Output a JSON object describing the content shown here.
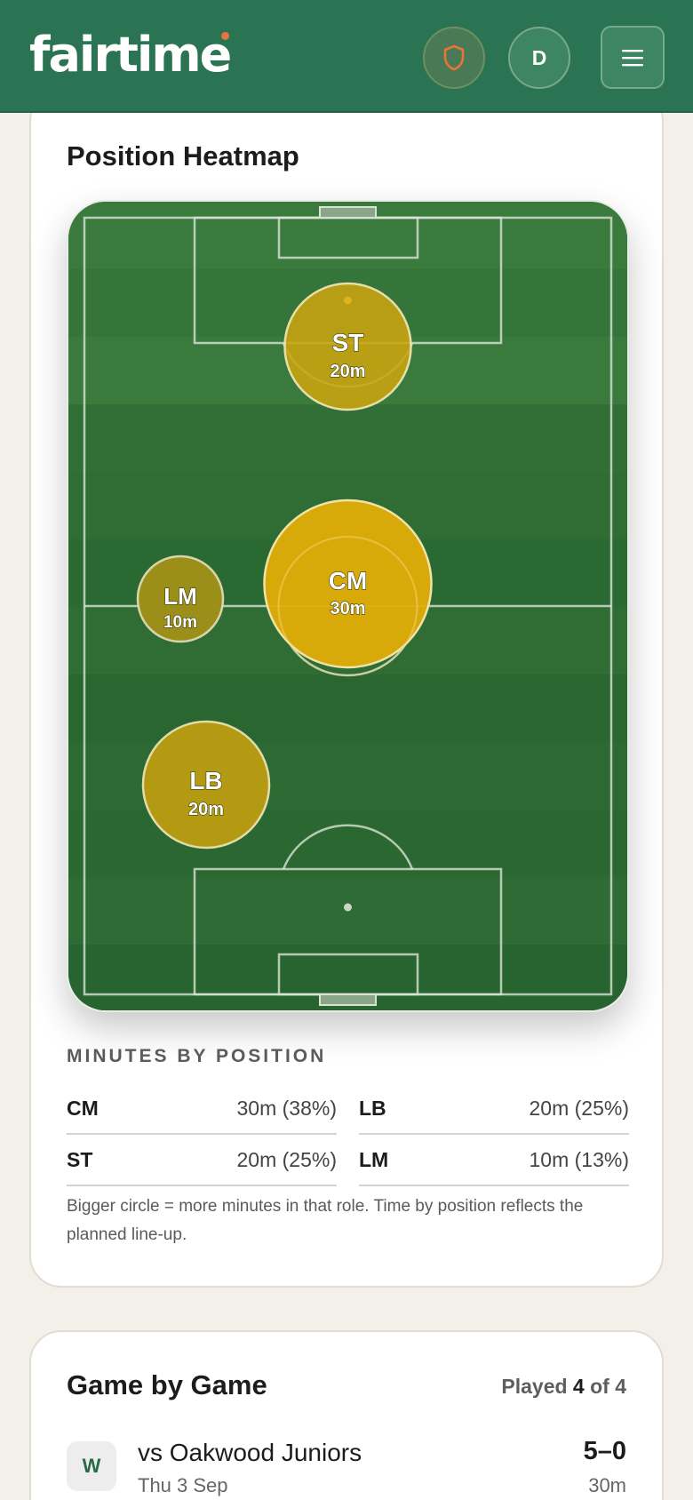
{
  "header": {
    "logo": "fairtime",
    "avatar_initial": "D",
    "icons": [
      "shield-icon",
      "menu-icon"
    ],
    "accent_color": "#e8743b",
    "brand_color": "#2a7454"
  },
  "heatmap": {
    "title": "Position Heatmap",
    "bubbles": [
      {
        "pos": "ST",
        "mins": "20m",
        "minutes": 20
      },
      {
        "pos": "CM",
        "mins": "30m",
        "minutes": 30
      },
      {
        "pos": "LM",
        "mins": "10m",
        "minutes": 10
      },
      {
        "pos": "LB",
        "mins": "20m",
        "minutes": 20
      }
    ]
  },
  "minutes": {
    "heading": "MINUTES BY POSITION",
    "rows": [
      {
        "pos": "CM",
        "value": "30m  (38%)"
      },
      {
        "pos": "LB",
        "value": "20m  (25%)"
      },
      {
        "pos": "ST",
        "value": "20m  (25%)"
      },
      {
        "pos": "LM",
        "value": "10m  (13%)"
      }
    ],
    "note": "Bigger circle = more minutes in that role. Time by position reflects the planned line-up."
  },
  "games": {
    "title": "Game by Game",
    "played_prefix": "Played",
    "played_count": "4",
    "played_of": "of 4",
    "items": [
      {
        "result": "W",
        "opponent": "vs Oakwood Juniors",
        "date": "Thu 3 Sep",
        "score": "5–0",
        "minutes": "30m"
      }
    ]
  }
}
